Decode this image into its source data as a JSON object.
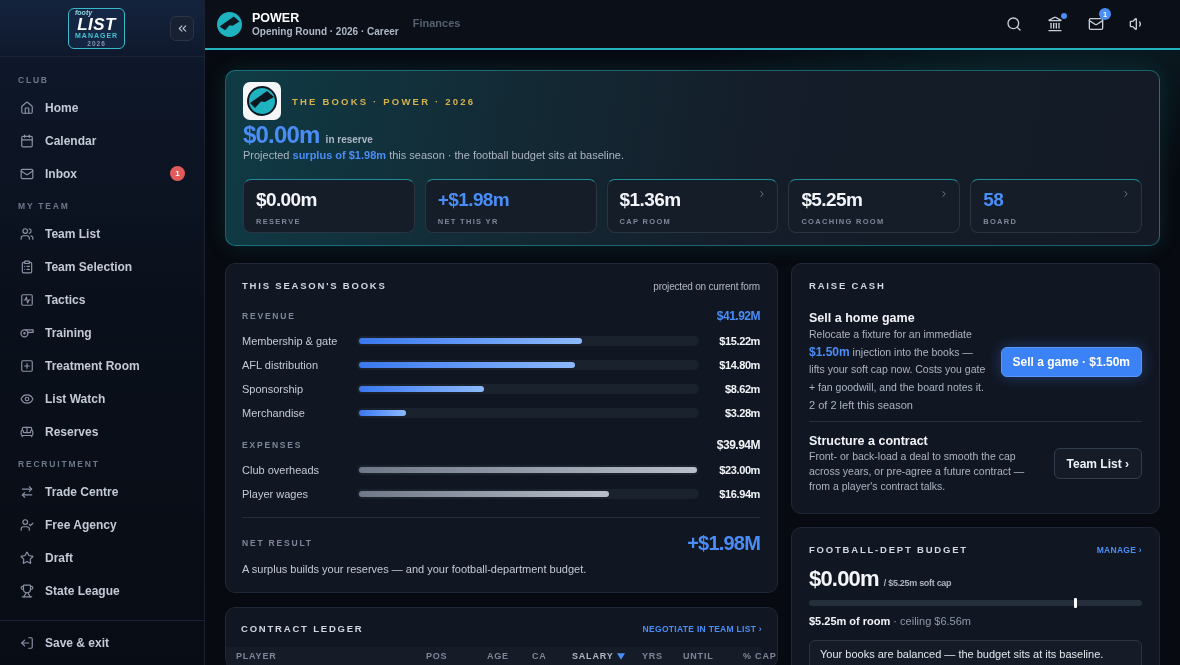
{
  "sidebar": {
    "logo": {
      "tagline": "footy",
      "wordmark": "LIST",
      "subtitle": "MANAGER",
      "year": "2026"
    },
    "sections": [
      {
        "title": "CLUB",
        "items": [
          {
            "label": "Home",
            "selected": false
          },
          {
            "label": "Calendar",
            "selected": false
          },
          {
            "label": "Inbox",
            "selected": false,
            "badge": "1"
          }
        ]
      },
      {
        "title": "MY TEAM",
        "items": [
          {
            "label": "Team List",
            "selected": false
          },
          {
            "label": "Team Selection",
            "selected": false
          },
          {
            "label": "Tactics",
            "selected": false
          },
          {
            "label": "Training",
            "selected": false
          },
          {
            "label": "Treatment Room",
            "selected": false
          },
          {
            "label": "List Watch",
            "selected": false
          },
          {
            "label": "Reserves",
            "selected": false
          }
        ]
      },
      {
        "title": "RECRUITMENT",
        "items": [
          {
            "label": "Trade Centre",
            "selected": false
          },
          {
            "label": "Free Agency",
            "selected": false
          },
          {
            "label": "Draft",
            "selected": false
          },
          {
            "label": "State League",
            "selected": false
          }
        ]
      }
    ],
    "exit": {
      "label": "Save & exit"
    }
  },
  "header": {
    "club": "POWER",
    "subtitle": "Opening Round · 2026 · Career",
    "page": "Finances",
    "bank_alert": true,
    "mail_badge": "1"
  },
  "hero": {
    "eyebrow": "THE BOOKS · POWER · 2026",
    "amount": "$0.00m",
    "amount_label": "in reserve",
    "summary": "Projected **surplus of $1.98m** this season · the football budget sits at baseline.",
    "stats": [
      {
        "value": "$0.00m",
        "label": "RESERVE",
        "kind": "neutral",
        "linked": false
      },
      {
        "value": "+$1.98m",
        "label": "NET THIS YR",
        "kind": "positive",
        "linked": false
      },
      {
        "value": "$1.36m",
        "label": "CAP ROOM",
        "kind": "neutral",
        "linked": true
      },
      {
        "value": "$5.25m",
        "label": "COACHING ROOM",
        "kind": "neutral",
        "linked": true
      },
      {
        "value": "58",
        "label": "BOARD",
        "kind": "positive",
        "linked": true
      }
    ]
  },
  "books": {
    "title": "THIS SEASON'S BOOKS",
    "note": "projected on current form",
    "groups": [
      {
        "kind": "revenue",
        "title": "REVENUE",
        "total": "$41.92M",
        "items": [
          {
            "label": "Membership & gate",
            "value": "$15.22m",
            "level": 0.66
          },
          {
            "label": "AFL distribution",
            "value": "$14.80m",
            "level": 0.64
          },
          {
            "label": "Sponsorship",
            "value": "$8.62m",
            "level": 0.37
          },
          {
            "label": "Merchandise",
            "value": "$3.28m",
            "level": 0.14
          }
        ]
      },
      {
        "kind": "expense",
        "title": "EXPENSES",
        "total": "$39.94M",
        "items": [
          {
            "label": "Club overheads",
            "value": "$23.00m",
            "level": 1.0
          },
          {
            "label": "Player wages",
            "value": "$16.94m",
            "level": 0.74
          }
        ]
      }
    ],
    "net": {
      "label": "NET RESULT",
      "value": "+$1.98M"
    },
    "footnote": "A surplus builds your reserves — and your football-department budget."
  },
  "raise_cash": {
    "title": "RAISE CASH",
    "options": [
      {
        "kind": "primary",
        "title": "Sell a home game",
        "description": "Relocate a fixture for an immediate **$1.50m** injection into the books — lifts your soft cap now. Costs you gate + fan goodwill, and the board notes it.",
        "note": "2 of 2 left this season",
        "button": "Sell a game · $1.50m"
      },
      {
        "kind": "secondary",
        "title": "Structure a contract",
        "description": "Front- or back-load a deal to smooth the cap across years, or pre-agree a future contract — from a player's contract talks.",
        "button": "Team List ›"
      }
    ]
  },
  "budget": {
    "title": "FOOTBALL-DEPT BUDGET",
    "link": "MANAGE ›",
    "amount": "$0.00m",
    "cap": "/ $5.25m soft cap",
    "soft_cap_marker": {
      "level": 0.8
    },
    "room": "**$5.25m of room** · ceiling $6.56m",
    "message": "Your books are balanced — the budget sits at its baseline."
  },
  "ledger": {
    "title": "CONTRACT LEDGER",
    "link": "NEGOTIATE IN TEAM LIST ›",
    "columns": [
      {
        "label": "PLAYER",
        "sorted": false
      },
      {
        "label": "POS",
        "sorted": false
      },
      {
        "label": "AGE",
        "sorted": false
      },
      {
        "label": "CA",
        "sorted": false
      },
      {
        "label": "SALARY",
        "sorted": true
      },
      {
        "label": "YRS",
        "sorted": false
      },
      {
        "label": "UNTIL",
        "sorted": false
      },
      {
        "label": "% CAP",
        "sorted": false
      }
    ]
  }
}
